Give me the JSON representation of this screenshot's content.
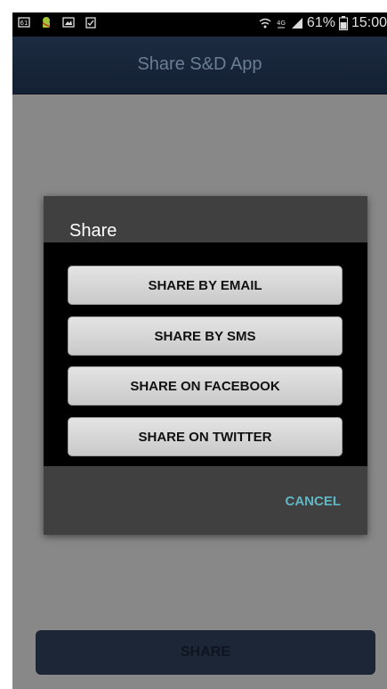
{
  "status_bar": {
    "left_icons": [
      "notification-61-icon",
      "android-debug-icon",
      "image-icon",
      "clipboard-check-icon"
    ],
    "right_icons": [
      "wifi-icon",
      "lte-4g-icon",
      "signal-icon"
    ],
    "battery_percent": "61%",
    "time": "15:00"
  },
  "app_bar": {
    "title": "Share S&D App"
  },
  "dialog": {
    "title": "Share",
    "options": [
      {
        "label": "SHARE BY EMAIL"
      },
      {
        "label": "SHARE BY SMS"
      },
      {
        "label": "SHARE ON FACEBOOK"
      },
      {
        "label": "SHARE ON TWITTER"
      }
    ],
    "cancel_label": "CANCEL"
  },
  "main": {
    "share_button_label": "SHARE"
  },
  "colors": {
    "app_bar": "#1d2b40",
    "dialog_bg": "#404040",
    "dialog_body": "#000000",
    "accent": "#5fb7c5",
    "scrim": "#888888"
  }
}
